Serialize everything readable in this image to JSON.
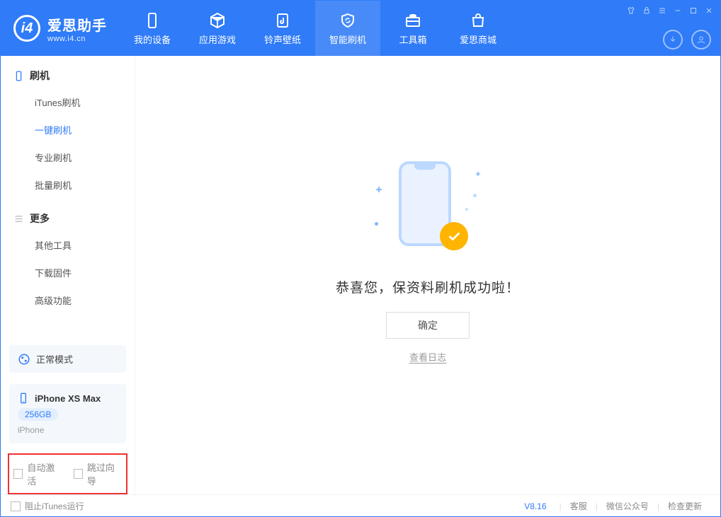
{
  "app": {
    "name": "爱思助手",
    "url": "www.i4.cn"
  },
  "nav": {
    "device": "我的设备",
    "apps": "应用游戏",
    "ringtone": "铃声壁纸",
    "flash": "智能刷机",
    "toolbox": "工具箱",
    "store": "爱思商城"
  },
  "sidebar": {
    "group_flash": "刷机",
    "items_flash": {
      "itunes": "iTunes刷机",
      "onekey": "一键刷机",
      "pro": "专业刷机",
      "batch": "批量刷机"
    },
    "group_more": "更多",
    "items_more": {
      "other": "其他工具",
      "firmware": "下载固件",
      "advanced": "高级功能"
    }
  },
  "status": {
    "mode": "正常模式"
  },
  "device": {
    "name": "iPhone XS Max",
    "storage": "256GB",
    "type": "iPhone"
  },
  "options": {
    "auto_activate": "自动激活",
    "skip_guide": "跳过向导"
  },
  "main": {
    "success": "恭喜您，保资料刷机成功啦！",
    "ok": "确定",
    "view_log": "查看日志"
  },
  "footer": {
    "block_itunes": "阻止iTunes运行",
    "version": "V8.16",
    "support": "客服",
    "wechat": "微信公众号",
    "update": "检查更新"
  }
}
